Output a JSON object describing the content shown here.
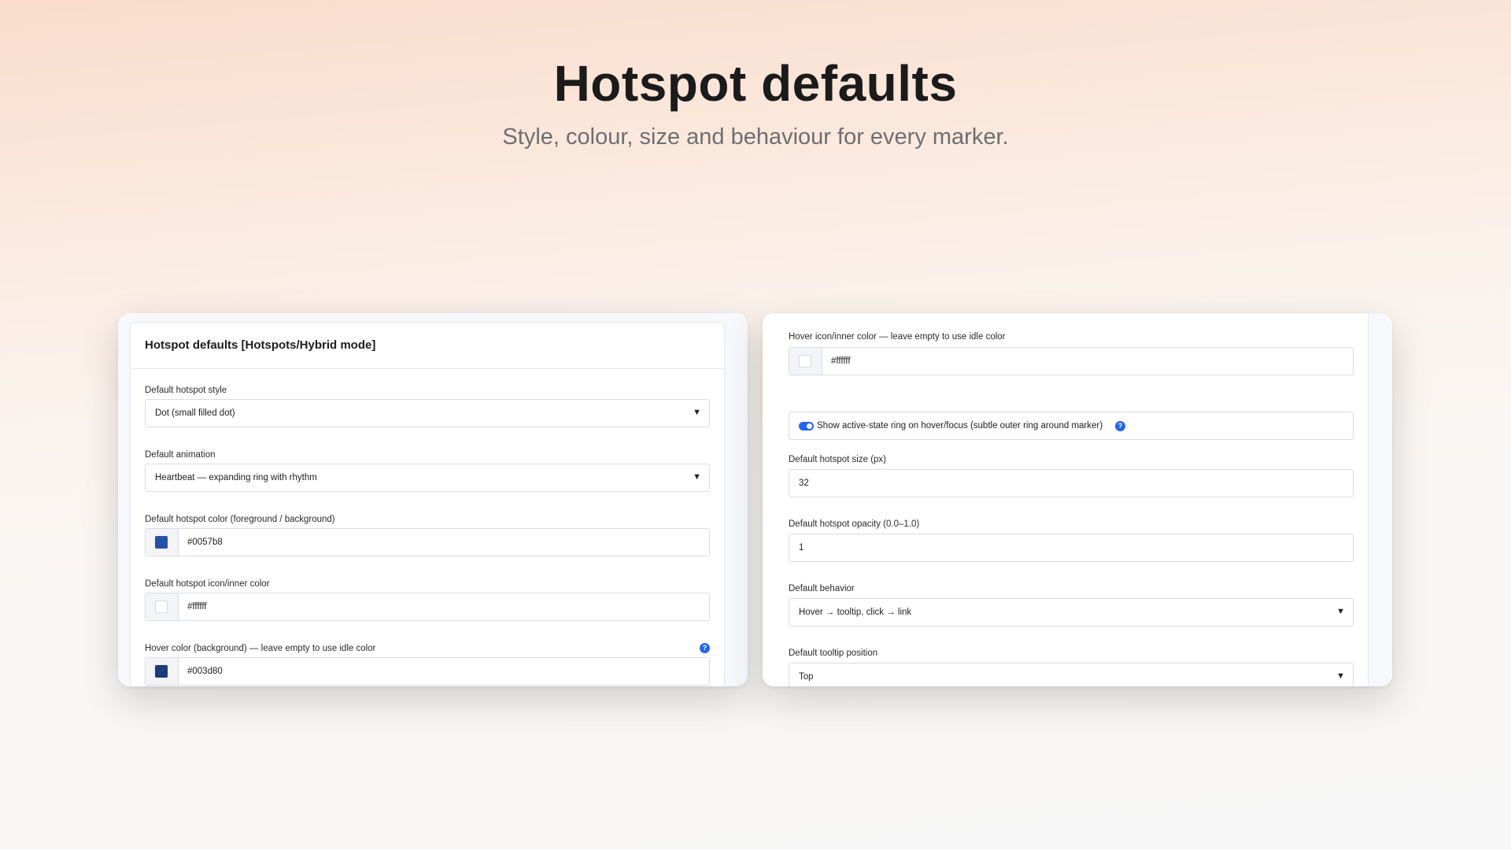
{
  "hero": {
    "title": "Hotspot defaults",
    "subtitle": "Style, colour, size and behaviour for every marker."
  },
  "left_panel": {
    "title": "Hotspot defaults [Hotspots/Hybrid mode]",
    "style": {
      "label": "Default hotspot style",
      "value": "Dot (small filled dot)",
      "icon": "chevron-down-icon"
    },
    "animation": {
      "label": "Default animation",
      "value": "Heartbeat — expanding ring with rhythm",
      "icon": "chevron-down-icon"
    },
    "color": {
      "label": "Default hotspot color (foreground / background)",
      "value": "#0057b8",
      "swatch": "#2452a8"
    },
    "icon_color": {
      "label": "Default hotspot icon/inner color",
      "value": "#ffffff",
      "swatch": "#ffffff"
    },
    "hover_color": {
      "label": "Hover color (background) — leave empty to use idle color",
      "value": "#003d80",
      "swatch": "#1b3d7a",
      "help": "?"
    }
  },
  "right_panel": {
    "hover_icon_color": {
      "label": "Hover icon/inner color — leave empty to use idle color",
      "value": "#ffffff",
      "swatch": "#ffffff"
    },
    "active_ring": {
      "label": "Show active-state ring on hover/focus (subtle outer ring around marker)",
      "enabled": true,
      "help": "?"
    },
    "size": {
      "label": "Default hotspot size (px)",
      "value": "32"
    },
    "opacity": {
      "label": "Default hotspot opacity (0.0–1.0)",
      "value": "1"
    },
    "behavior": {
      "label": "Default behavior",
      "value": "Hover → tooltip, click → link",
      "icon": "chevron-down-icon"
    },
    "tooltip_position": {
      "label": "Default tooltip position",
      "value": "Top",
      "icon": "chevron-down-icon"
    }
  },
  "colors": {
    "accent": "#2563eb"
  }
}
